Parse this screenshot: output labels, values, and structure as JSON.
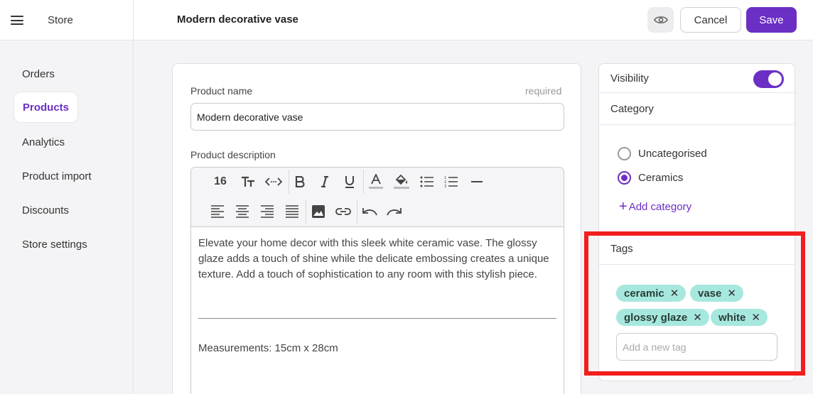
{
  "header": {
    "store_label": "Store",
    "page_title": "Modern decorative vase",
    "cancel_label": "Cancel",
    "save_label": "Save",
    "preview_icon": "eye-icon",
    "menu_icon": "hamburger-icon"
  },
  "sidebar": {
    "items": [
      {
        "label": "Orders",
        "active": false
      },
      {
        "label": "Products",
        "active": true
      },
      {
        "label": "Analytics",
        "active": false
      },
      {
        "label": "Product import",
        "active": false
      },
      {
        "label": "Discounts",
        "active": false
      },
      {
        "label": "Store settings",
        "active": false
      }
    ]
  },
  "product": {
    "name_label": "Product name",
    "required_hint": "required",
    "name_value": "Modern decorative vase",
    "description_label": "Product description",
    "font_size": "16",
    "description_paragraph": "Elevate your home decor with this sleek white ceramic vase. The glossy glaze adds a touch of shine while the delicate embossing creates a unique texture. Add a touch of sophistication to any room with this stylish piece.",
    "measurements": "Measurements: 15cm x 28cm"
  },
  "toolbar_icons": [
    "font-size-icon",
    "text-style-icon",
    "code-icon",
    "bold-icon",
    "italic-icon",
    "underline-icon",
    "text-color-icon",
    "highlight-color-icon",
    "bullet-list-icon",
    "numbered-list-icon",
    "horizontal-rule-icon",
    "align-left-icon",
    "align-center-icon",
    "align-right-icon",
    "align-justify-icon",
    "image-icon",
    "link-icon",
    "undo-icon",
    "redo-icon"
  ],
  "right_panel": {
    "visibility_label": "Visibility",
    "visibility_on": true,
    "category_label": "Category",
    "categories": [
      {
        "label": "Uncategorised",
        "selected": false
      },
      {
        "label": "Ceramics",
        "selected": true
      }
    ],
    "add_category_label": "Add category",
    "tags_label": "Tags",
    "tags": [
      "ceramic",
      "vase",
      "glossy glaze",
      "white"
    ],
    "tag_placeholder": "Add a new tag"
  },
  "colors": {
    "accent": "#6b2fc4",
    "tag_bg": "#a6e8dd",
    "highlight": "#f21e1e"
  }
}
